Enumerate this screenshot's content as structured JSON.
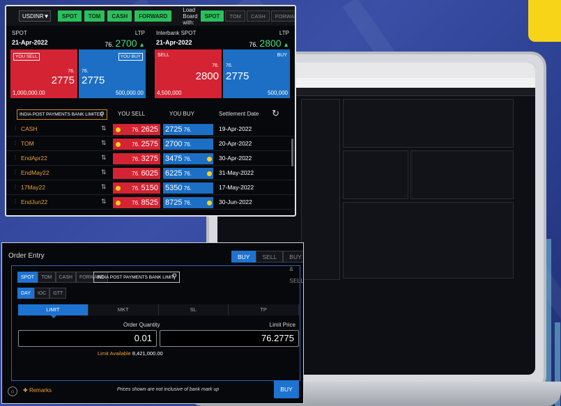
{
  "toolbar": {
    "pair": "USDINR",
    "tenor_buttons": [
      "SPOT",
      "TOM",
      "CASH",
      "FORWARD"
    ],
    "load_board_label": "Load Board with:",
    "load_options": [
      "SPOT",
      "TOM",
      "CASH",
      "FORWARD"
    ]
  },
  "cards": [
    {
      "label": "SPOT",
      "ltp_label": "LTP",
      "date": "21-Apr-2022",
      "ltp_prefix": "76.",
      "ltp_value": "2700",
      "sell_tag": "YOU SELL",
      "buy_tag": "YOU BUY",
      "sell_prefix": "76.",
      "sell_value": "2775",
      "buy_prefix": "76.",
      "buy_value": "2775",
      "sell_amount": "1,000,000.00",
      "buy_amount": "500,000.00"
    },
    {
      "label": "Interbank SPOT",
      "ltp_label": "LTP",
      "date": "21-Apr-2022",
      "ltp_prefix": "76.",
      "ltp_value": "2800",
      "sell_tag": "SELL",
      "buy_tag": "BUY",
      "sell_prefix": "76.",
      "sell_value": "2800",
      "buy_prefix": "76.",
      "buy_value": "2775",
      "sell_amount": "4,500,000",
      "buy_amount": "500,000"
    }
  ],
  "table": {
    "search_value": "INDIA POST PAYMENTS BANK LIMITED",
    "headers": [
      "YOU SELL",
      "YOU BUY",
      "Settlement Date"
    ],
    "rows": [
      {
        "name": "CASH",
        "sell_prefix": "76.",
        "sell": "2625",
        "buy": "2725",
        "buy_suffix": "76.",
        "date": "19-Apr-2022"
      },
      {
        "name": "TOM",
        "sell_prefix": "76.",
        "sell": "2575",
        "buy": "2700",
        "buy_suffix": "76.",
        "date": "20-Apr-2022"
      },
      {
        "name": "EndApr22",
        "sell_prefix": "76.",
        "sell": "3275",
        "buy": "3475",
        "buy_suffix": "76.",
        "date": "30-Apr-2022"
      },
      {
        "name": "EndMay22",
        "sell_prefix": "76.",
        "sell": "6025",
        "buy": "6225",
        "buy_suffix": "76.",
        "date": "31-May-2022"
      },
      {
        "name": "17May22",
        "sell_prefix": "76.",
        "sell": "5150",
        "buy": "5350",
        "buy_suffix": "76.",
        "date": "17-May-2022"
      },
      {
        "name": "EndJun22",
        "sell_prefix": "76.",
        "sell": "8525",
        "buy": "8725",
        "buy_suffix": "76.",
        "date": "30-Jun-2022"
      }
    ]
  },
  "order_entry": {
    "title": "Order Entry",
    "sides": [
      "BUY",
      "SELL",
      "BUY & SELL"
    ],
    "tenors": [
      "SPOT",
      "TOM",
      "CASH",
      "FORWARD"
    ],
    "counterparty": "INDIA POST PAYMENTS BANK LIMIT",
    "validity": [
      "DAY",
      "IOC",
      "GTT"
    ],
    "order_types": [
      "LIMIT",
      "MKT",
      "SL",
      "TP"
    ],
    "qty_label": "Order Quantity",
    "price_label": "Limit Price",
    "qty_value": "0.01",
    "price_value": "76.2775",
    "limit_label": "Limit Available",
    "limit_value": "8,421,000.00",
    "remarks": "Remarks",
    "note": "Prices shown are not inclusive of bank mark up",
    "buy_label": "BUY"
  },
  "colors": {
    "sell": "#d42333",
    "buy": "#1c6fc4",
    "accent": "#2bbf5d",
    "tenor": "#e8a23a"
  }
}
